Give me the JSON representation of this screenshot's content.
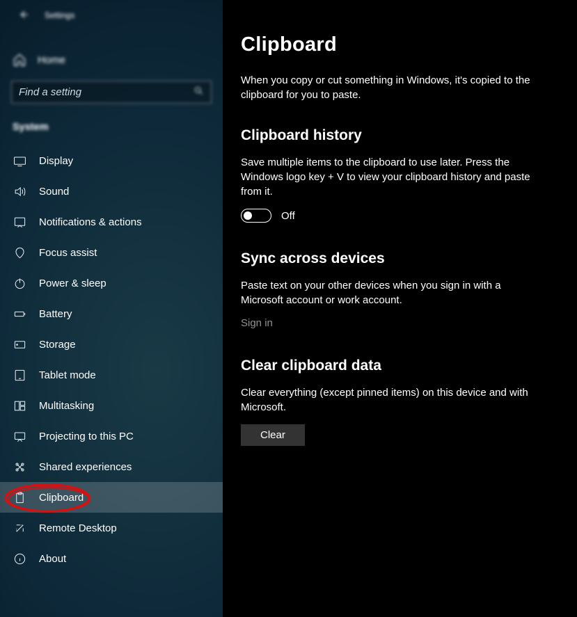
{
  "window": {
    "title": "Settings"
  },
  "sidebar": {
    "home_label": "Home",
    "search_placeholder": "Find a setting",
    "section_label": "System",
    "items": [
      {
        "label": "Display"
      },
      {
        "label": "Sound"
      },
      {
        "label": "Notifications & actions"
      },
      {
        "label": "Focus assist"
      },
      {
        "label": "Power & sleep"
      },
      {
        "label": "Battery"
      },
      {
        "label": "Storage"
      },
      {
        "label": "Tablet mode"
      },
      {
        "label": "Multitasking"
      },
      {
        "label": "Projecting to this PC"
      },
      {
        "label": "Shared experiences"
      },
      {
        "label": "Clipboard"
      },
      {
        "label": "Remote Desktop"
      },
      {
        "label": "About"
      }
    ],
    "active_index": 11
  },
  "page": {
    "title": "Clipboard",
    "intro": "When you copy or cut something in Windows, it's copied to the clipboard for you to paste.",
    "history": {
      "title": "Clipboard history",
      "desc": "Save multiple items to the clipboard to use later. Press the Windows logo key + V to view your clipboard history and paste from it.",
      "toggle_state": "Off"
    },
    "sync": {
      "title": "Sync across devices",
      "desc": "Paste text on your other devices when you sign in with a Microsoft account or work account.",
      "signin_label": "Sign in"
    },
    "clear": {
      "title": "Clear clipboard data",
      "desc": "Clear everything (except pinned items) on this device and with Microsoft.",
      "button_label": "Clear"
    }
  }
}
